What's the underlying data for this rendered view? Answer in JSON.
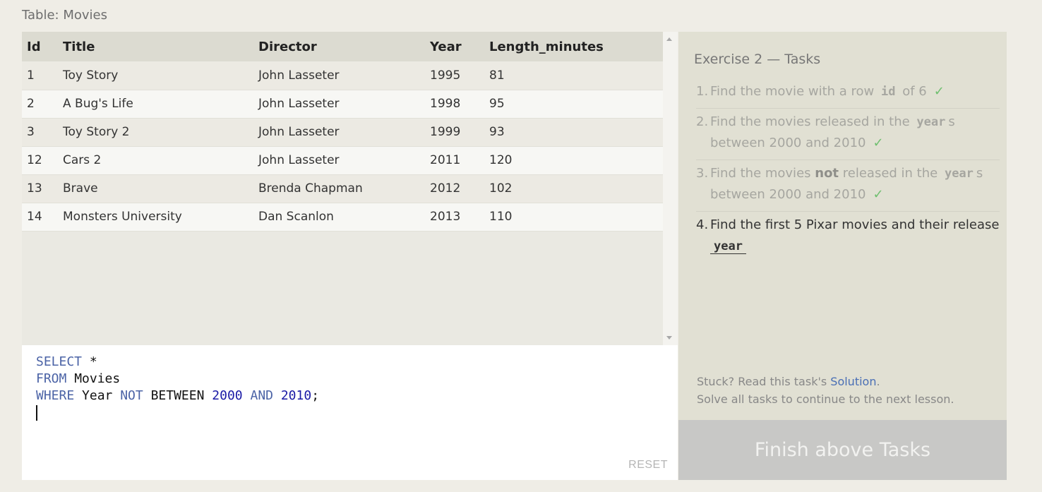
{
  "table_label": "Table: Movies",
  "results": {
    "columns": [
      "Id",
      "Title",
      "Director",
      "Year",
      "Length_minutes"
    ],
    "rows": [
      [
        "1",
        "Toy Story",
        "John Lasseter",
        "1995",
        "81"
      ],
      [
        "2",
        "A Bug's Life",
        "John Lasseter",
        "1998",
        "95"
      ],
      [
        "3",
        "Toy Story 2",
        "John Lasseter",
        "1999",
        "93"
      ],
      [
        "12",
        "Cars 2",
        "John Lasseter",
        "2011",
        "120"
      ],
      [
        "13",
        "Brave",
        "Brenda Chapman",
        "2012",
        "102"
      ],
      [
        "14",
        "Monsters University",
        "Dan Scanlon",
        "2013",
        "110"
      ]
    ]
  },
  "editor": {
    "line1_kw": "SELECT",
    "line1_rest": " *",
    "line2_kw": "FROM",
    "line2_rest": " Movies",
    "line3_kw1": "WHERE",
    "line3_ident": " Year ",
    "line3_kw2": "NOT",
    "line3_between": " BETWEEN ",
    "line3_num1": "2000",
    "line3_kw3": " AND ",
    "line3_num2": "2010",
    "line3_end": ";",
    "reset_label": "RESET"
  },
  "tasks": {
    "title": "Exercise 2 — Tasks",
    "items": [
      {
        "num": "1.",
        "pre": "Find the movie with a row ",
        "code": "id",
        "post": " of 6",
        "done": true,
        "check": "✓"
      },
      {
        "num": "2.",
        "pre": "Find the movies released in the ",
        "code": "year",
        "post": "s between 2000 and 2010",
        "done": true,
        "check": "✓"
      },
      {
        "num": "3.",
        "pre": "Find the movies ",
        "bold": "not",
        "mid": " released in the ",
        "code": "year",
        "post": "s between 2000 and 2010",
        "done": true,
        "check": "✓"
      },
      {
        "num": "4.",
        "pre": "Find the first 5 Pixar movies and their release",
        "code": "year",
        "done": false
      }
    ],
    "stuck_prefix": "Stuck? Read this task's ",
    "solution_link": "Solution",
    "stuck_suffix": ".",
    "solve_all": "Solve all tasks to continue to the next lesson.",
    "finish_label": "Finish above Tasks"
  }
}
